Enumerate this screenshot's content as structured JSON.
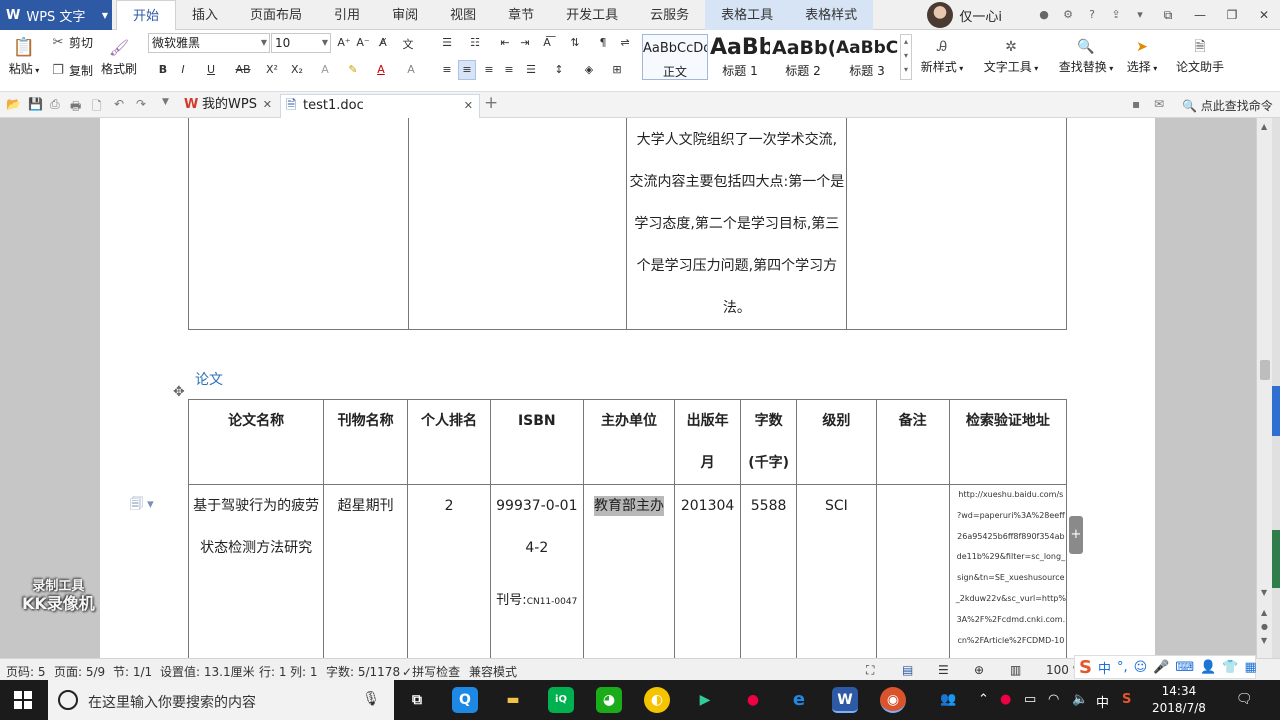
{
  "app": {
    "name": "WPS 文字",
    "logo_glyph": "W",
    "accent": "#2e5aa5"
  },
  "menu_tabs": [
    "开始",
    "插入",
    "页面布局",
    "引用",
    "审阅",
    "视图",
    "章节",
    "开发工具",
    "云服务",
    "表格工具",
    "表格样式"
  ],
  "user": {
    "name": "仅一心i"
  },
  "window_controls": {
    "minimize": "—",
    "restore": "❐",
    "close": "✕"
  },
  "ribbon": {
    "paste": "粘贴",
    "cut": "剪切",
    "copy": "复制",
    "format_painter": "格式刷",
    "font_name": "微软雅黑",
    "font_size": "10",
    "styles": [
      {
        "sample": "AaBbCcDd",
        "name": "正文"
      },
      {
        "sample": "AaBb",
        "name": "标题 1"
      },
      {
        "sample": "AaBb(",
        "name": "标题 2"
      },
      {
        "sample": "AaBbC",
        "name": "标题 3"
      }
    ],
    "new_style": "新样式",
    "text_tools": "文字工具",
    "find_replace": "查找替换",
    "select": "选择",
    "thesis_assistant": "论文助手"
  },
  "doc_tabs": {
    "home": "我的WPS",
    "current": "test1.doc",
    "new_tab": "+"
  },
  "quick_search": "点此查找命令",
  "document": {
    "upper_table_text": [
      "大学人文院组织了一次学术交流,",
      "交流内容主要包括四大点:第一个是",
      "学习态度,第二个是学习目标,第三",
      "个是学习压力问题,第四个学习方",
      "法。"
    ],
    "section_title": "论文",
    "table_headers": [
      "论文名称",
      "刊物名称",
      "个人排名",
      "ISBN",
      "主办单位",
      [
        "出版年",
        "月"
      ],
      [
        "字数",
        "(千字)"
      ],
      "级别",
      "备注",
      "检索验证地址"
    ],
    "row": {
      "title": [
        "基于驾驶行为的疲劳",
        "状态检测方法研究"
      ],
      "journal": "超星期刊",
      "rank": "2",
      "isbn": [
        "99937-0-01",
        "4-2"
      ],
      "issn_label": "刊号:",
      "issn_value": "CN11-0047",
      "organizer": "教育部主办",
      "date": "201304",
      "words": "5588",
      "level": "SCI",
      "remark": "",
      "url_lines": [
        "http://xueshu.baidu.com/s",
        "?wd=paperuri%3A%28eeff",
        "26a95425b6ff8f890f354ab",
        "de11b%29&filter=sc_long_",
        "sign&tn=SE_xueshusource",
        "_2kduw22v&sc_vurl=http%",
        "3A%2F%2Fcdmd.cnki.com.",
        "cn%2FArticle%2FCDMD-10",
        "..."
      ]
    }
  },
  "watermark": {
    "line1": "录制工具",
    "line2": "KK录像机"
  },
  "status_bar": {
    "page_no": "页码: 5",
    "page": "页面: 5/9",
    "section": "节: 1/1",
    "setting": "设置值: 13.1厘米",
    "row": "行: 1",
    "col": "列: 1",
    "words": "字数: 5/1178",
    "spell": "拼写检查",
    "compat": "兼容模式",
    "zoom": "100 %"
  },
  "taskbar": {
    "search_placeholder": "在这里输入你要搜索的内容",
    "time": "14:34",
    "date": "2018/7/8",
    "ime": "中"
  }
}
